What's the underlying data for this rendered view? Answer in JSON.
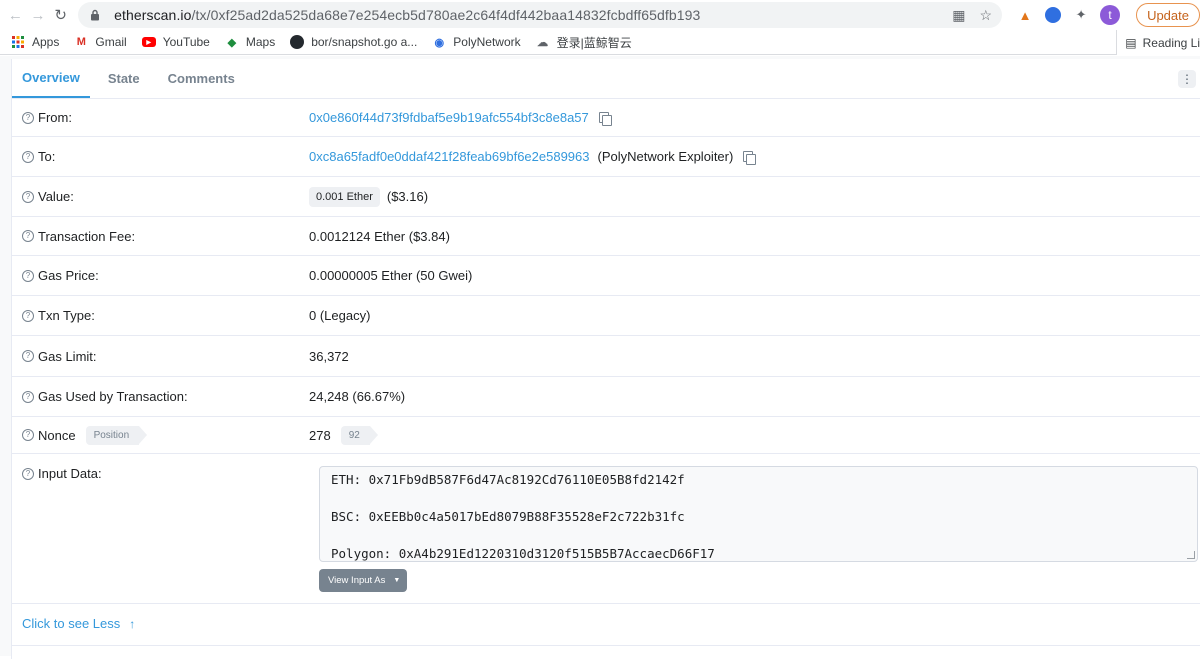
{
  "browser": {
    "url_host": "etherscan.io",
    "url_path": "/tx/0xf25ad2da525da68e7e254ecb5d780ae2c64f4df442baa14832fcbdff65dfb193",
    "profile_initial": "t",
    "update_label": "Update"
  },
  "bookmarks": {
    "items": [
      "Apps",
      "Gmail",
      "YouTube",
      "Maps",
      "bor/snapshot.go a...",
      "PolyNetwork",
      "登录|蓝鲸智云"
    ],
    "reading_list": "Reading Li"
  },
  "tabs": [
    "Overview",
    "State",
    "Comments"
  ],
  "rows": {
    "from": {
      "label": "From:",
      "address": "0x0e860f44d73f9fdbaf5e9b19afc554bf3c8e8a57"
    },
    "to": {
      "label": "To:",
      "address": "0xc8a65fadf0e0ddaf421f28feab69bf6e2e589963",
      "tag": "(PolyNetwork Exploiter)"
    },
    "value": {
      "label": "Value:",
      "amount": "0.001 Ether",
      "usd": "($3.16)"
    },
    "fee": {
      "label": "Transaction Fee:",
      "text": "0.0012124 Ether ($3.84)"
    },
    "gas_price": {
      "label": "Gas Price:",
      "text": "0.00000005 Ether (50 Gwei)"
    },
    "txn_type": {
      "label": "Txn Type:",
      "text": "0 (Legacy)"
    },
    "gas_limit": {
      "label": "Gas Limit:",
      "text": "36,372"
    },
    "gas_used": {
      "label": "Gas Used by Transaction:",
      "text": "24,248 (66.67%)"
    },
    "nonce": {
      "label": "Nonce",
      "position_tag": "Position",
      "nonce": "278",
      "position": "92"
    },
    "input": {
      "label": "Input Data:",
      "line1": "ETH: 0x71Fb9dB587F6d47Ac8192Cd76110E05B8fd2142f",
      "line2": "BSC: 0xEEBb0c4a5017bEd8079B88F35528eF2c722b31fc",
      "line3": "Polygon: 0xA4b291Ed1220310d3120f515B5B7AccaecD66F17",
      "view_button": "View Input As"
    }
  },
  "footer": {
    "less_label": "Click to see Less"
  },
  "colors": {
    "link": "#3498db",
    "update": "#c5631c"
  }
}
